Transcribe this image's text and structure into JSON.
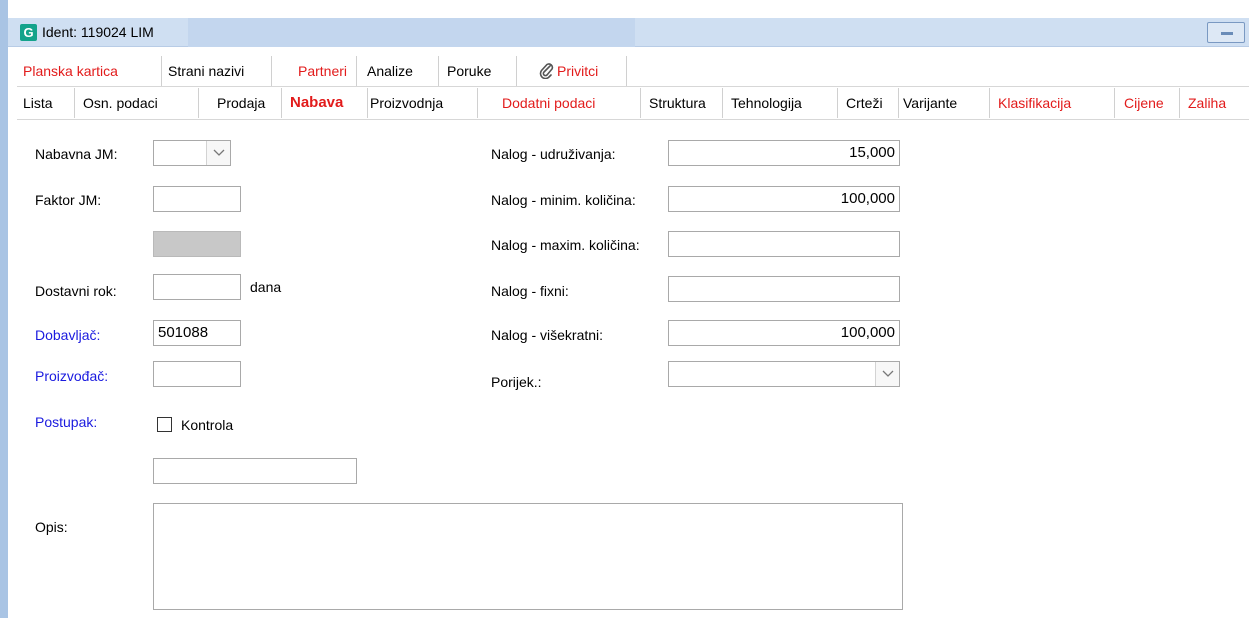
{
  "window": {
    "icon_letter": "G",
    "title": "Ident: 119024 LIM"
  },
  "tabs_top": [
    {
      "label": "Planska kartica",
      "red": true
    },
    {
      "label": "Strani nazivi",
      "red": false
    },
    {
      "label": "Partneri",
      "red": true
    },
    {
      "label": "Analize",
      "red": false
    },
    {
      "label": "Poruke",
      "red": false
    },
    {
      "label": "Privitci",
      "red": true,
      "icon": "paperclip-icon"
    }
  ],
  "tabs_bottom": [
    {
      "label": "Lista",
      "red": false
    },
    {
      "label": "Osn. podaci",
      "red": false
    },
    {
      "label": "Prodaja",
      "red": false
    },
    {
      "label": "Nabava",
      "red": true,
      "active": true
    },
    {
      "label": "Proizvodnja",
      "red": false
    },
    {
      "label": "Dodatni podaci",
      "red": true
    },
    {
      "label": "Struktura",
      "red": false
    },
    {
      "label": "Tehnologija",
      "red": false
    },
    {
      "label": "Crteži",
      "red": false
    },
    {
      "label": "Varijante",
      "red": false
    },
    {
      "label": "Klasifikacija",
      "red": true
    },
    {
      "label": "Cijene",
      "red": true
    },
    {
      "label": "Zaliha",
      "red": true
    }
  ],
  "form": {
    "nabavna_jm": {
      "label": "Nabavna JM:",
      "value": ""
    },
    "faktor_jm": {
      "label": "Faktor JM:",
      "value": ""
    },
    "dostavni_rok": {
      "label": "Dostavni rok:",
      "value": "",
      "unit": "dana"
    },
    "dobavljac": {
      "label": "Dobavljač:",
      "value": "501088"
    },
    "proizvodac": {
      "label": "Proizvođač:",
      "value": ""
    },
    "postupak": {
      "label": "Postupak:",
      "checkbox_label": "Kontrola",
      "checked": false,
      "value": ""
    },
    "opis": {
      "label": "Opis:",
      "value": ""
    },
    "nalog_udruzivanja": {
      "label": "Nalog - udruživanja:",
      "value": "15,000"
    },
    "nalog_minim": {
      "label": "Nalog - minim. količina:",
      "value": "100,000"
    },
    "nalog_maxim": {
      "label": "Nalog - maxim. količina:",
      "value": ""
    },
    "nalog_fixni": {
      "label": "Nalog - fixni:",
      "value": ""
    },
    "nalog_visekratni": {
      "label": "Nalog - višekratni:",
      "value": "100,000"
    },
    "porijek": {
      "label": "Porijek.:",
      "value": ""
    }
  },
  "colors": {
    "red_tab": "#e21b1b",
    "blue_label": "#1a1adf",
    "titlebar": "#cfdff2",
    "app_icon": "#14a38b"
  }
}
